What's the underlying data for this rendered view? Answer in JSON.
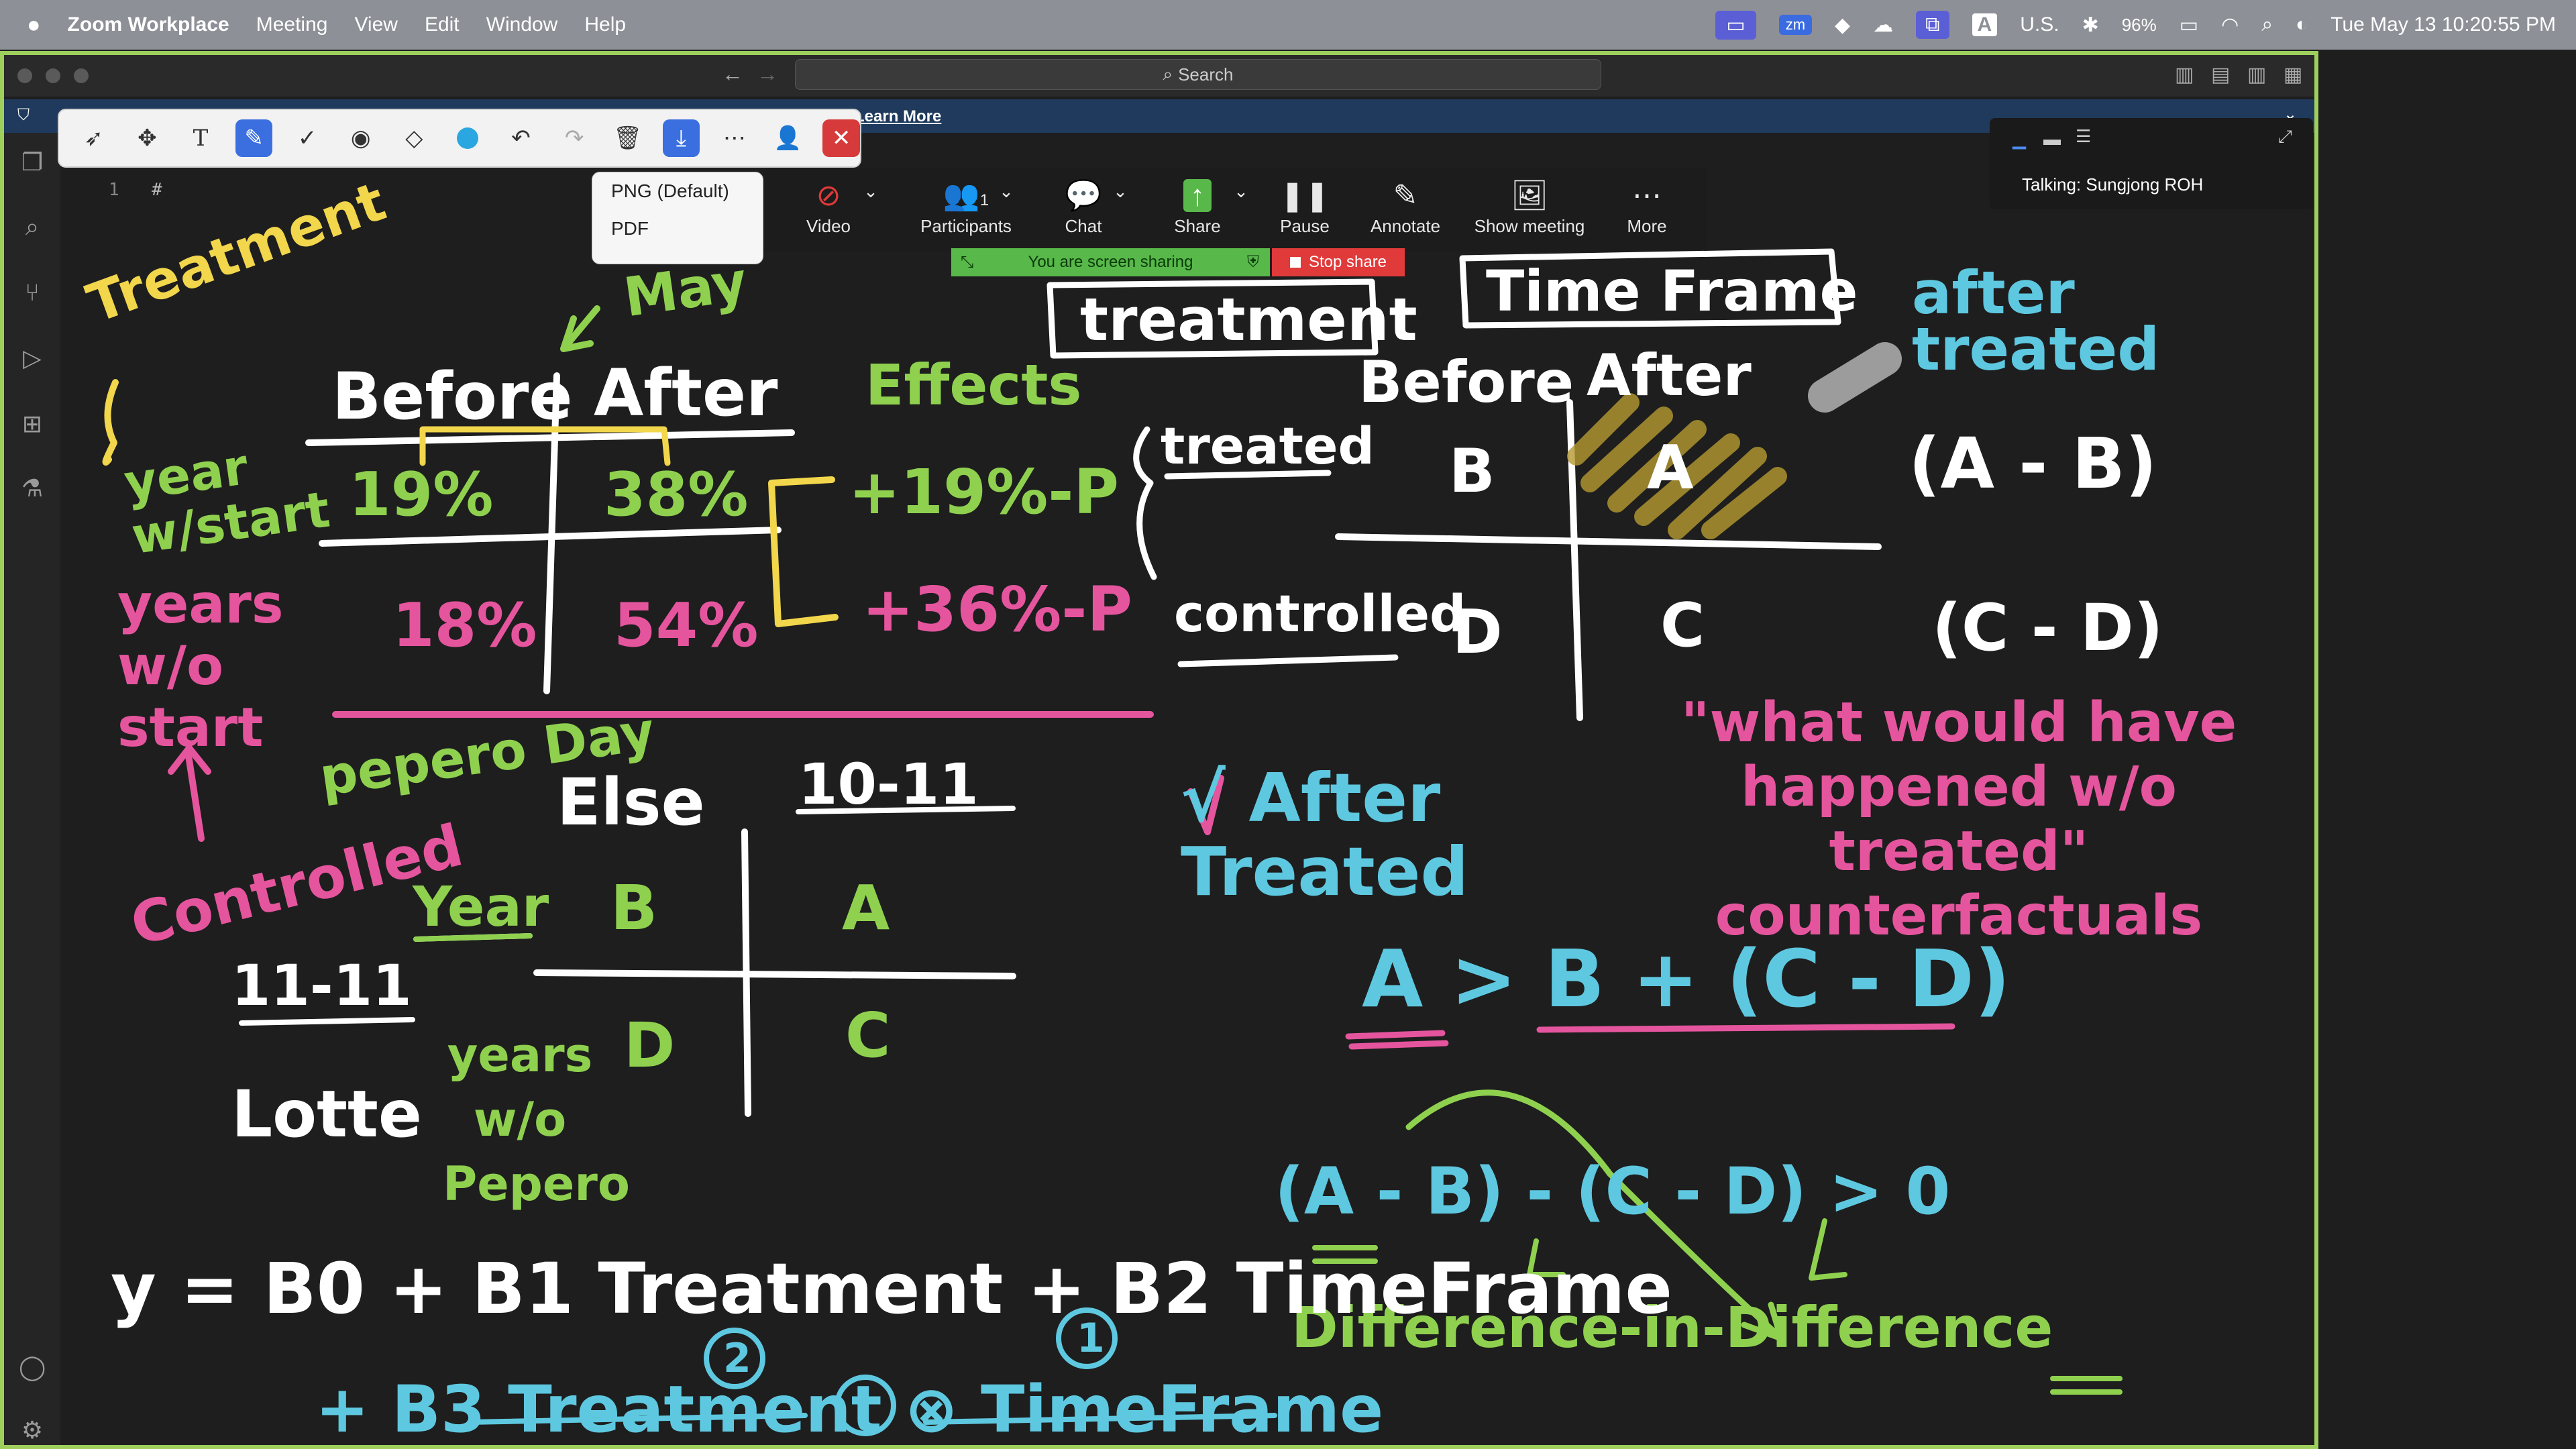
{
  "menubar": {
    "app": "Zoom Workplace",
    "items": [
      "Meeting",
      "View",
      "Edit",
      "Window",
      "Help"
    ],
    "keyboard": "U.S.",
    "battery": "96%",
    "datetime": "Tue May 13  10:20:55 PM"
  },
  "editor": {
    "search_placeholder": "Search",
    "banner_link": "Learn More",
    "line_number": "1",
    "line_content": "#"
  },
  "export_menu": {
    "options": [
      "PNG (Default)",
      "PDF"
    ]
  },
  "zoom_controls": {
    "video": "Video",
    "participants": "Participants",
    "participants_count": "1",
    "chat": "Chat",
    "share": "Share",
    "pause": "Pause",
    "annotate": "Annotate",
    "show_meeting": "Show meeting",
    "more": "More",
    "sharing_status": "You are screen sharing",
    "stop_share": "Stop share",
    "talking": "Talking: Sungjong ROH"
  },
  "notes": {
    "treatment_label": "Treatment",
    "may": "May",
    "before": "Before",
    "after": "After",
    "effects": "Effects",
    "year_w_start": "year w/start",
    "years_wo_start": "years w/o start",
    "v19": "19%",
    "v38": "38%",
    "v18": "18%",
    "v54": "54%",
    "eff1": "+19%-P",
    "eff2": "+36%-P",
    "controlled": "Controlled",
    "pepero_day": "pepero Day",
    "else": "Else",
    "range1": "10-11",
    "year_u": "Year",
    "B": "B",
    "A": "A",
    "D": "D",
    "C": "C",
    "range2": "11-11",
    "lotte": "Lotte",
    "years_wo_pepero": "years w/o Pepero",
    "box_treatment": "treatment",
    "box_timeframe": "Time Frame",
    "after_treated_top": "after treated",
    "before2": "Before",
    "after2": "After",
    "treated": "treated",
    "controlled2": "controlled",
    "ab": "(A - B)",
    "cd": "(C - D)",
    "counterfactual": "\"what would have happened w/o treated\" counterfactuals",
    "check_after_treated": "√ After Treated",
    "inequality": "A > B + (C - D)",
    "did_expr": "(A - B) - (C - D) > 0",
    "did_label": "Difference-in-Difference",
    "eq_line1": "y = B0 + B1 Treatment + B2 TimeFrame",
    "eq_line2": "+ B3 Treatment ⊗ TimeFrame",
    "circ2": "2",
    "circ1": "1"
  },
  "colors": {
    "canvas": "#1e1e1e",
    "menubar": "#8e9097",
    "window_border": "#9ecf5d",
    "ink_cyan": "#5ec8e0",
    "ink_green": "#8fd14f",
    "ink_pink": "#e5559e",
    "ink_yellow": "#f2d64b",
    "ink_white": "#ffffff"
  }
}
